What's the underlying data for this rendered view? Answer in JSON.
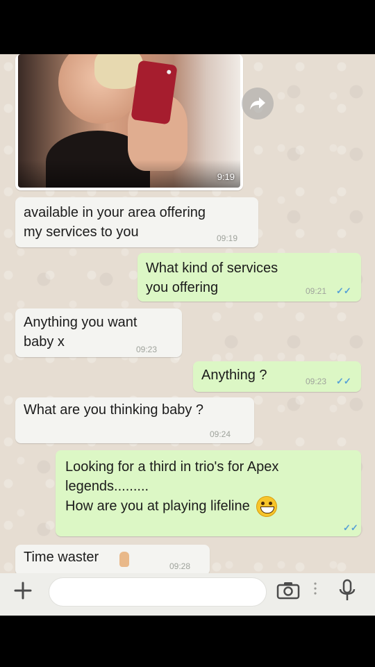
{
  "chat": {
    "photo_time": "9:19",
    "messages": [
      {
        "text": "available in your area offering\nmy services to you",
        "time": "09:19",
        "direction": "in"
      },
      {
        "text": "What kind of services\nyou offering",
        "time": "09:21",
        "direction": "out",
        "ticks": "✓✓"
      },
      {
        "text": "Anything you want\nbaby x",
        "time": "09:23",
        "direction": "in"
      },
      {
        "text": "Anything ?",
        "time": "09:23",
        "direction": "out",
        "ticks": "✓✓"
      },
      {
        "text": "What are you thinking baby ?",
        "time": "09:24",
        "direction": "in"
      },
      {
        "text": "Looking for a third in trio's for Apex\nlegends.........\nHow are you at playing lifeline",
        "time": "",
        "direction": "out",
        "ticks": "✓✓"
      },
      {
        "text": "Time waster",
        "time": "09:28",
        "direction": "in"
      }
    ]
  },
  "input": {
    "placeholder": "",
    "icons": [
      "plus-icon",
      "camera-icon",
      "more-icon",
      "microphone-icon"
    ]
  },
  "colors": {
    "incoming": "#f4f4f1",
    "outgoing": "#dcf7c5",
    "background": "#e6ddd2",
    "ticks": "#56a0d6"
  }
}
